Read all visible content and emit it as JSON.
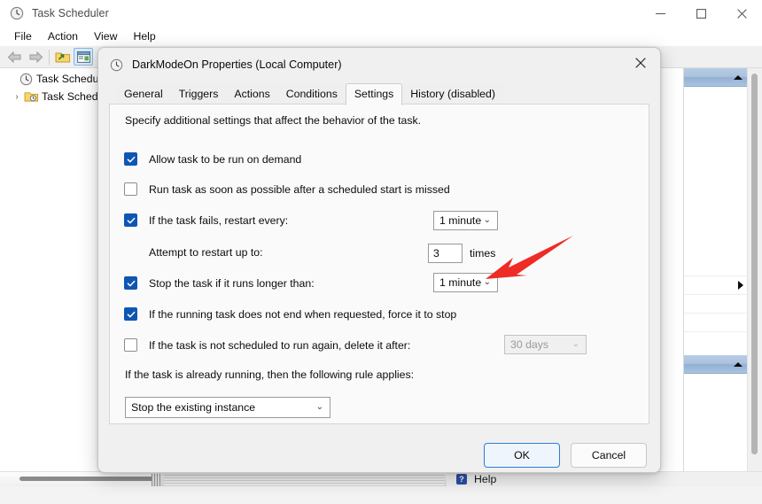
{
  "window": {
    "title": "Task Scheduler",
    "icon": "clock-icon",
    "controls": {
      "minimize": "minimize-button",
      "maximize": "maximize-button",
      "close": "close-button"
    },
    "menu": [
      "File",
      "Action",
      "View",
      "Help"
    ],
    "toolbar": {
      "back": "back-arrow-icon",
      "forward": "forward-arrow-icon",
      "open_folder": "open-folder-icon",
      "show_properties": "properties-pane-icon"
    },
    "tree": [
      {
        "label": "Task Scheduler (",
        "icon": "clock-icon",
        "twisty": "",
        "indent": 0
      },
      {
        "label": "Task Schedul",
        "icon": "task-folder-icon",
        "twisty": "›",
        "indent": 1
      }
    ],
    "help_label": "Help",
    "help_icon": "help-icon"
  },
  "dialog": {
    "title": "DarkModeOn Properties (Local Computer)",
    "icon": "clock-icon",
    "close_icon": "close-icon",
    "tabs": [
      {
        "label": "General",
        "active": false
      },
      {
        "label": "Triggers",
        "active": false
      },
      {
        "label": "Actions",
        "active": false
      },
      {
        "label": "Conditions",
        "active": false
      },
      {
        "label": "Settings",
        "active": true
      },
      {
        "label": "History (disabled)",
        "active": false
      }
    ],
    "description": "Specify additional settings that affect the behavior of the task.",
    "settings": [
      {
        "id": "allow-on-demand",
        "label": "Allow task to be run on demand",
        "checked": true
      },
      {
        "id": "run-asap-missed",
        "label": "Run task as soon as possible after a scheduled start is missed",
        "checked": false
      },
      {
        "id": "restart-on-failure",
        "label": "If the task fails, restart every:",
        "checked": true
      },
      {
        "id": "attempt-restart",
        "label": "Attempt to restart up to:",
        "checked": null
      },
      {
        "id": "stop-if-longer",
        "label": "Stop the task if it runs longer than:",
        "checked": true
      },
      {
        "id": "force-stop",
        "label": "If the running task does not end when requested, force it to stop",
        "checked": true
      },
      {
        "id": "delete-after",
        "label": "If the task is not scheduled to run again, delete it after:",
        "checked": false
      }
    ],
    "restart_interval": {
      "value": "1 minute",
      "caret": "chevron-down-icon"
    },
    "restart_count": {
      "value": "3",
      "unit": "times"
    },
    "stop_duration": {
      "value": "1 minute",
      "caret": "chevron-down-icon"
    },
    "delete_after_period": {
      "value": "30 days",
      "caret": "chevron-down-icon",
      "disabled": true
    },
    "already_running_label": "If the task is already running, then the following rule applies:",
    "already_running_rule": {
      "value": "Stop the existing instance",
      "caret": "chevron-down-icon"
    },
    "buttons": {
      "ok": "OK",
      "cancel": "Cancel"
    }
  },
  "annotation": {
    "type": "red-arrow",
    "color": "#ee2b24",
    "points_to": "stop-duration-dropdown"
  },
  "colors": {
    "accent": "#0f56b3",
    "annotation_red": "#ee2b24",
    "pane_header_blue": "#a9c2de",
    "default_button_border": "#2b7fd4"
  }
}
